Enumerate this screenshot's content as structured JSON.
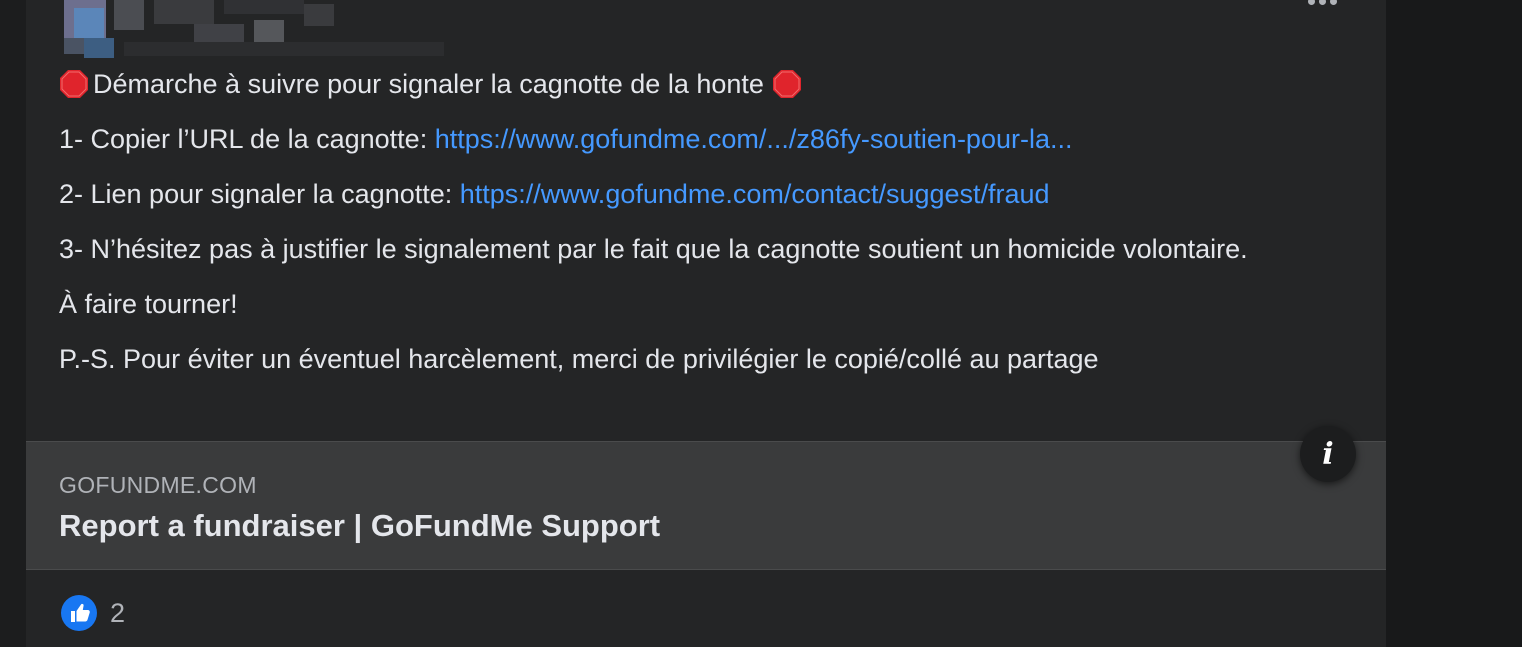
{
  "post": {
    "heading": "Démarche à suivre pour signaler la cagnotte de la honte",
    "step1_prefix": "1- Copier l’URL de la cagnotte: ",
    "step1_link": "https://www.gofundme.com/.../z86fy-soutien-pour-la...",
    "step2_prefix": "2- Lien pour signaler la cagnotte: ",
    "step2_link": "https://www.gofundme.com/contact/suggest/fraud",
    "step3": "3- N’hésitez pas à justifier le signalement par le fait que la cagnotte soutient un homicide volontaire.",
    "share": "À faire tourner!",
    "ps": "P.-S. Pour éviter un éventuel harcèlement, merci de privilégier le copié/collé au partage"
  },
  "link_preview": {
    "domain": "GOFUNDME.COM",
    "title": "Report a fundraiser | GoFundMe Support"
  },
  "reactions": {
    "count": "2",
    "icon": "like-icon"
  },
  "icons": {
    "heading": "stop-sign-icon",
    "info": "info-icon",
    "more": "more-options-icon"
  },
  "colors": {
    "link": "#4599ff",
    "stop": "#e0242c",
    "like": "#1877f2"
  }
}
